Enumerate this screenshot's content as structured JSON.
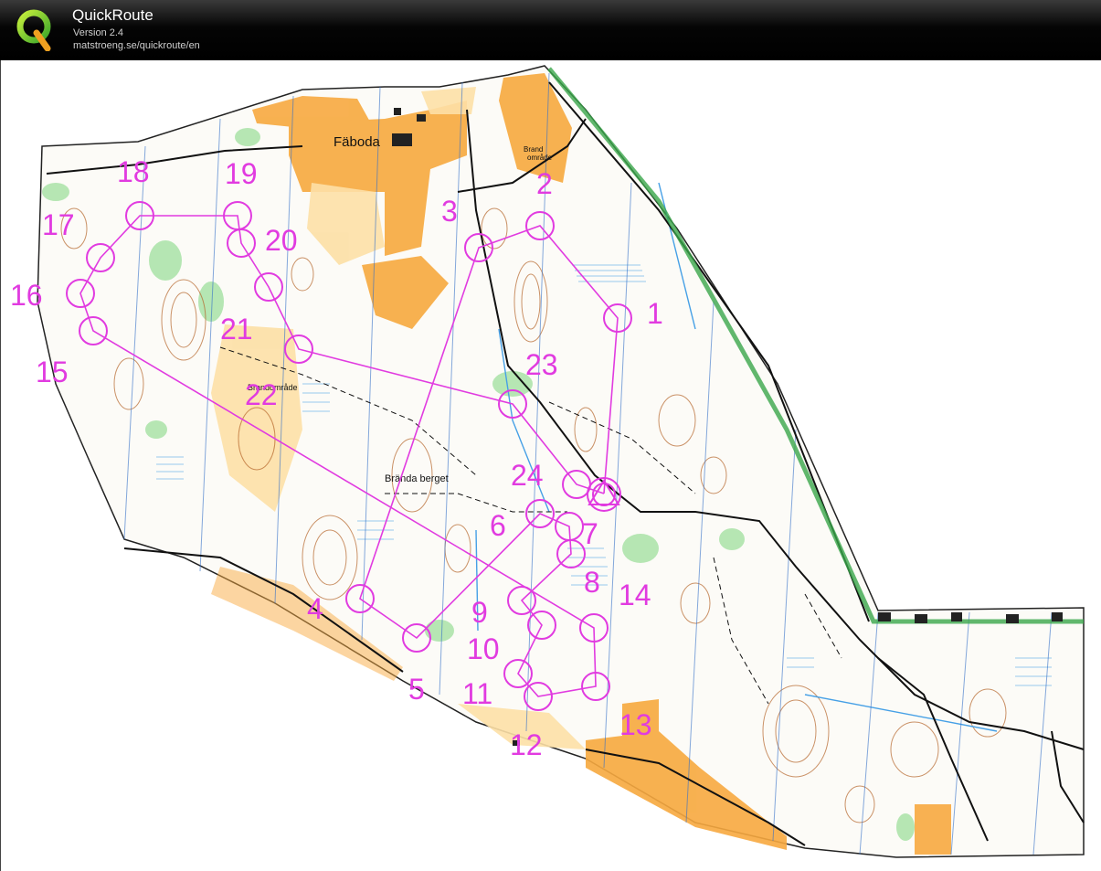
{
  "app": {
    "title": "QuickRoute",
    "version": "Version 2.4",
    "url": "matstroeng.se/quickroute/en",
    "logo_icon": "quickroute-q-logo-icon"
  },
  "colors": {
    "course": "#e13be0",
    "open_land": "#f7a93f",
    "rough_open": "#fde0a6",
    "green": "#7cd67c",
    "water": "#46a0e6",
    "contour": "#b5652a",
    "track": "#111111"
  },
  "map": {
    "place_labels": [
      {
        "id": "faboda",
        "text": "Fäboda"
      },
      {
        "id": "brand-omrade-ne",
        "text": "Brand"
      },
      {
        "id": "brand-omrade-ne2",
        "text": "område"
      },
      {
        "id": "brandomrade-w",
        "text": "Brandområde"
      },
      {
        "id": "branda-berget",
        "text": "Brända berget"
      }
    ]
  },
  "course": {
    "start_icon": "start-triangle-icon",
    "controls": [
      {
        "n": "1"
      },
      {
        "n": "2"
      },
      {
        "n": "3"
      },
      {
        "n": "4"
      },
      {
        "n": "5"
      },
      {
        "n": "6"
      },
      {
        "n": "7"
      },
      {
        "n": "8"
      },
      {
        "n": "9"
      },
      {
        "n": "10"
      },
      {
        "n": "11"
      },
      {
        "n": "12"
      },
      {
        "n": "13"
      },
      {
        "n": "14"
      },
      {
        "n": "15"
      },
      {
        "n": "16"
      },
      {
        "n": "17"
      },
      {
        "n": "18"
      },
      {
        "n": "19"
      },
      {
        "n": "20"
      },
      {
        "n": "21"
      },
      {
        "n": "22"
      },
      {
        "n": "23"
      },
      {
        "n": "24"
      }
    ]
  }
}
